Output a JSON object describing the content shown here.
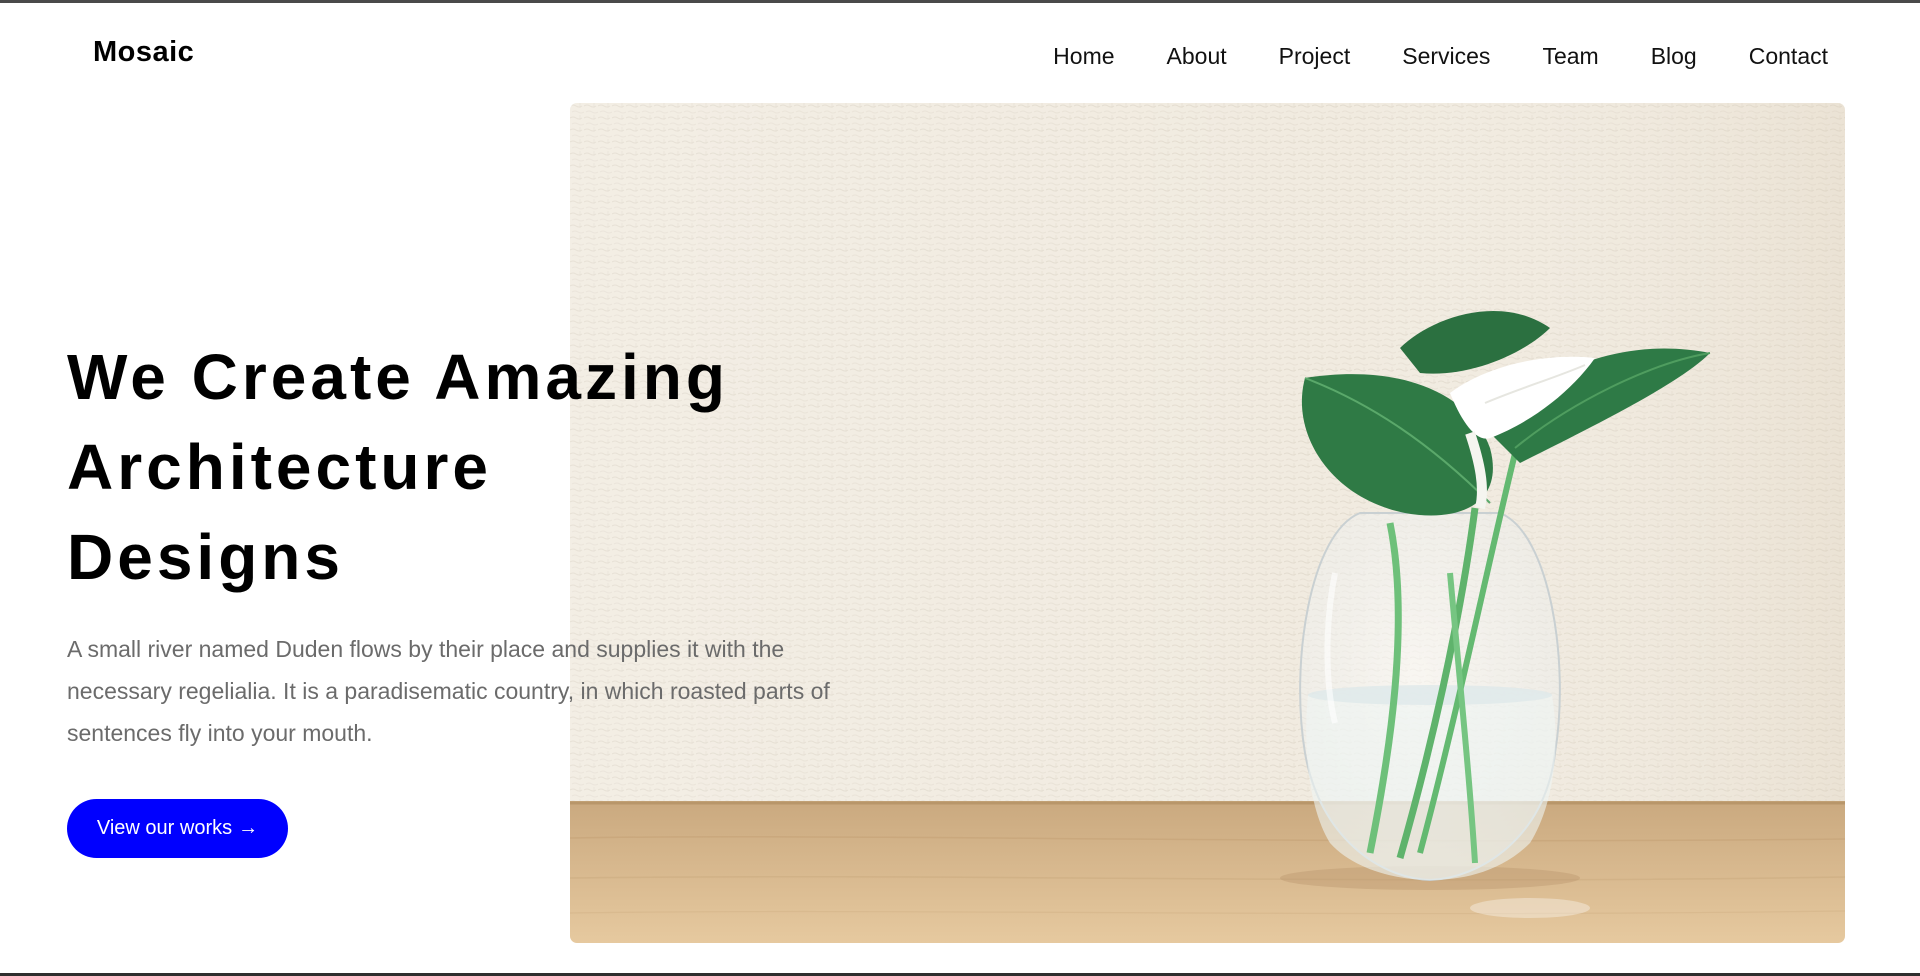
{
  "brand": {
    "name": "Mosaic"
  },
  "nav": {
    "items": [
      {
        "label": "Home"
      },
      {
        "label": "About"
      },
      {
        "label": "Project"
      },
      {
        "label": "Services"
      },
      {
        "label": "Team"
      },
      {
        "label": "Blog"
      },
      {
        "label": "Contact"
      }
    ]
  },
  "hero": {
    "headline_lines": [
      "We Create Amazing",
      "Architecture",
      "Designs"
    ],
    "description": "A small river named Duden flows by their place and supplies it with the necessary regelialia. It is a paradisematic country, in which roasted parts of sentences fly into your mouth.",
    "cta_label": "View our works",
    "cta_arrow": "→",
    "image_icon": "plant-in-glass-vase-photo"
  },
  "colors": {
    "accent": "#0000ff",
    "text": "#000000",
    "muted_text": "#6b6b6b",
    "wall": "#f1ebe0",
    "table": "#d9b98d",
    "leaf": "#2f7a45"
  }
}
